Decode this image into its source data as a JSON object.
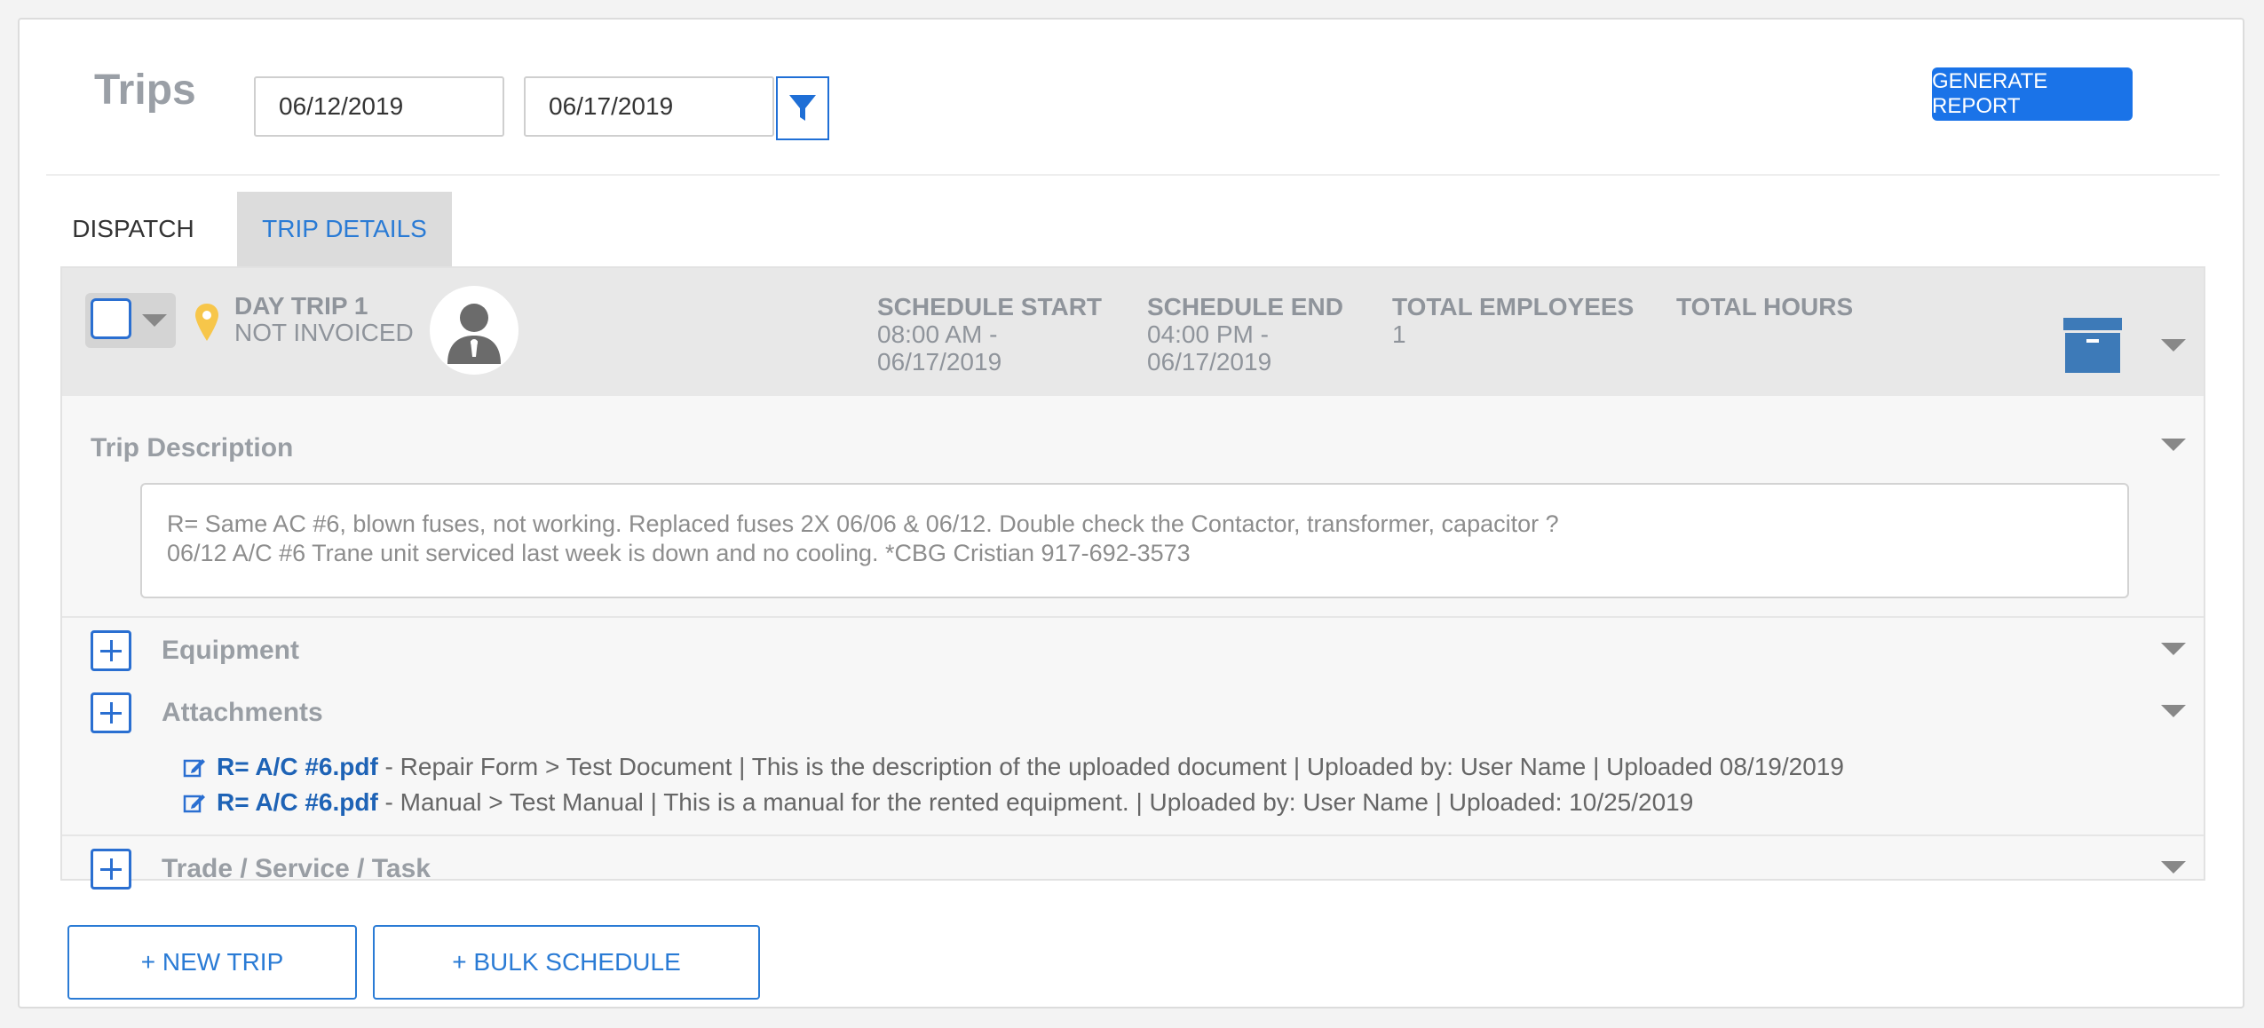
{
  "page": {
    "title": "Trips",
    "start_date": "06/12/2019",
    "end_date": "06/17/2019",
    "generate_report_label": "GENERATE REPORT"
  },
  "tabs": [
    {
      "label": "DISPATCH",
      "active": false
    },
    {
      "label": "TRIP DETAILS",
      "active": true
    }
  ],
  "trip": {
    "name": "DAY TRIP 1",
    "invoice_status": "NOT INVOICED",
    "schedule_start": {
      "label": "SCHEDULE START",
      "line1": "08:00 AM -",
      "line2": "06/17/2019"
    },
    "schedule_end": {
      "label": "SCHEDULE END",
      "line1": "04:00 PM -",
      "line2": "06/17/2019"
    },
    "total_employees": {
      "label": "TOTAL EMPLOYEES",
      "value": "1"
    },
    "total_hours": {
      "label": "TOTAL HOURS",
      "value": ""
    }
  },
  "description": {
    "title": "Trip Description",
    "line1": "R= Same AC #6, blown fuses, not working. Replaced fuses 2X 06/06 & 06/12. Double check the Contactor, transformer, capacitor ?",
    "line2": "06/12 A/C #6 Trane unit serviced last week is down and no cooling. *CBG  Cristian 917-692-3573"
  },
  "sections": {
    "equipment": "Equipment",
    "attachments": "Attachments",
    "trade": "Trade / Service / Task"
  },
  "attachments": [
    {
      "file": "R= A/C #6.pdf",
      "details": " - Repair Form > Test Document | This is the description of the uploaded document | Uploaded by: User Name | Uploaded 08/19/2019"
    },
    {
      "file": "R= A/C #6.pdf",
      "details": " - Manual > Test Manual |  This is a manual for the rented equipment. | Uploaded by: User Name | Uploaded: 10/25/2019"
    }
  ],
  "buttons": {
    "new_trip": "+ NEW TRIP",
    "bulk_schedule": "+ BULK SCHEDULE"
  },
  "colors": {
    "accent": "#1a73e8",
    "link": "#1e63b6",
    "pin": "#f7c64a",
    "archive": "#3d7ab8"
  },
  "icons": [
    "filter-icon",
    "location-pin-icon",
    "avatar-worker-icon",
    "archive-icon",
    "chevron-down-icon",
    "plus-square-icon",
    "edit-icon"
  ]
}
